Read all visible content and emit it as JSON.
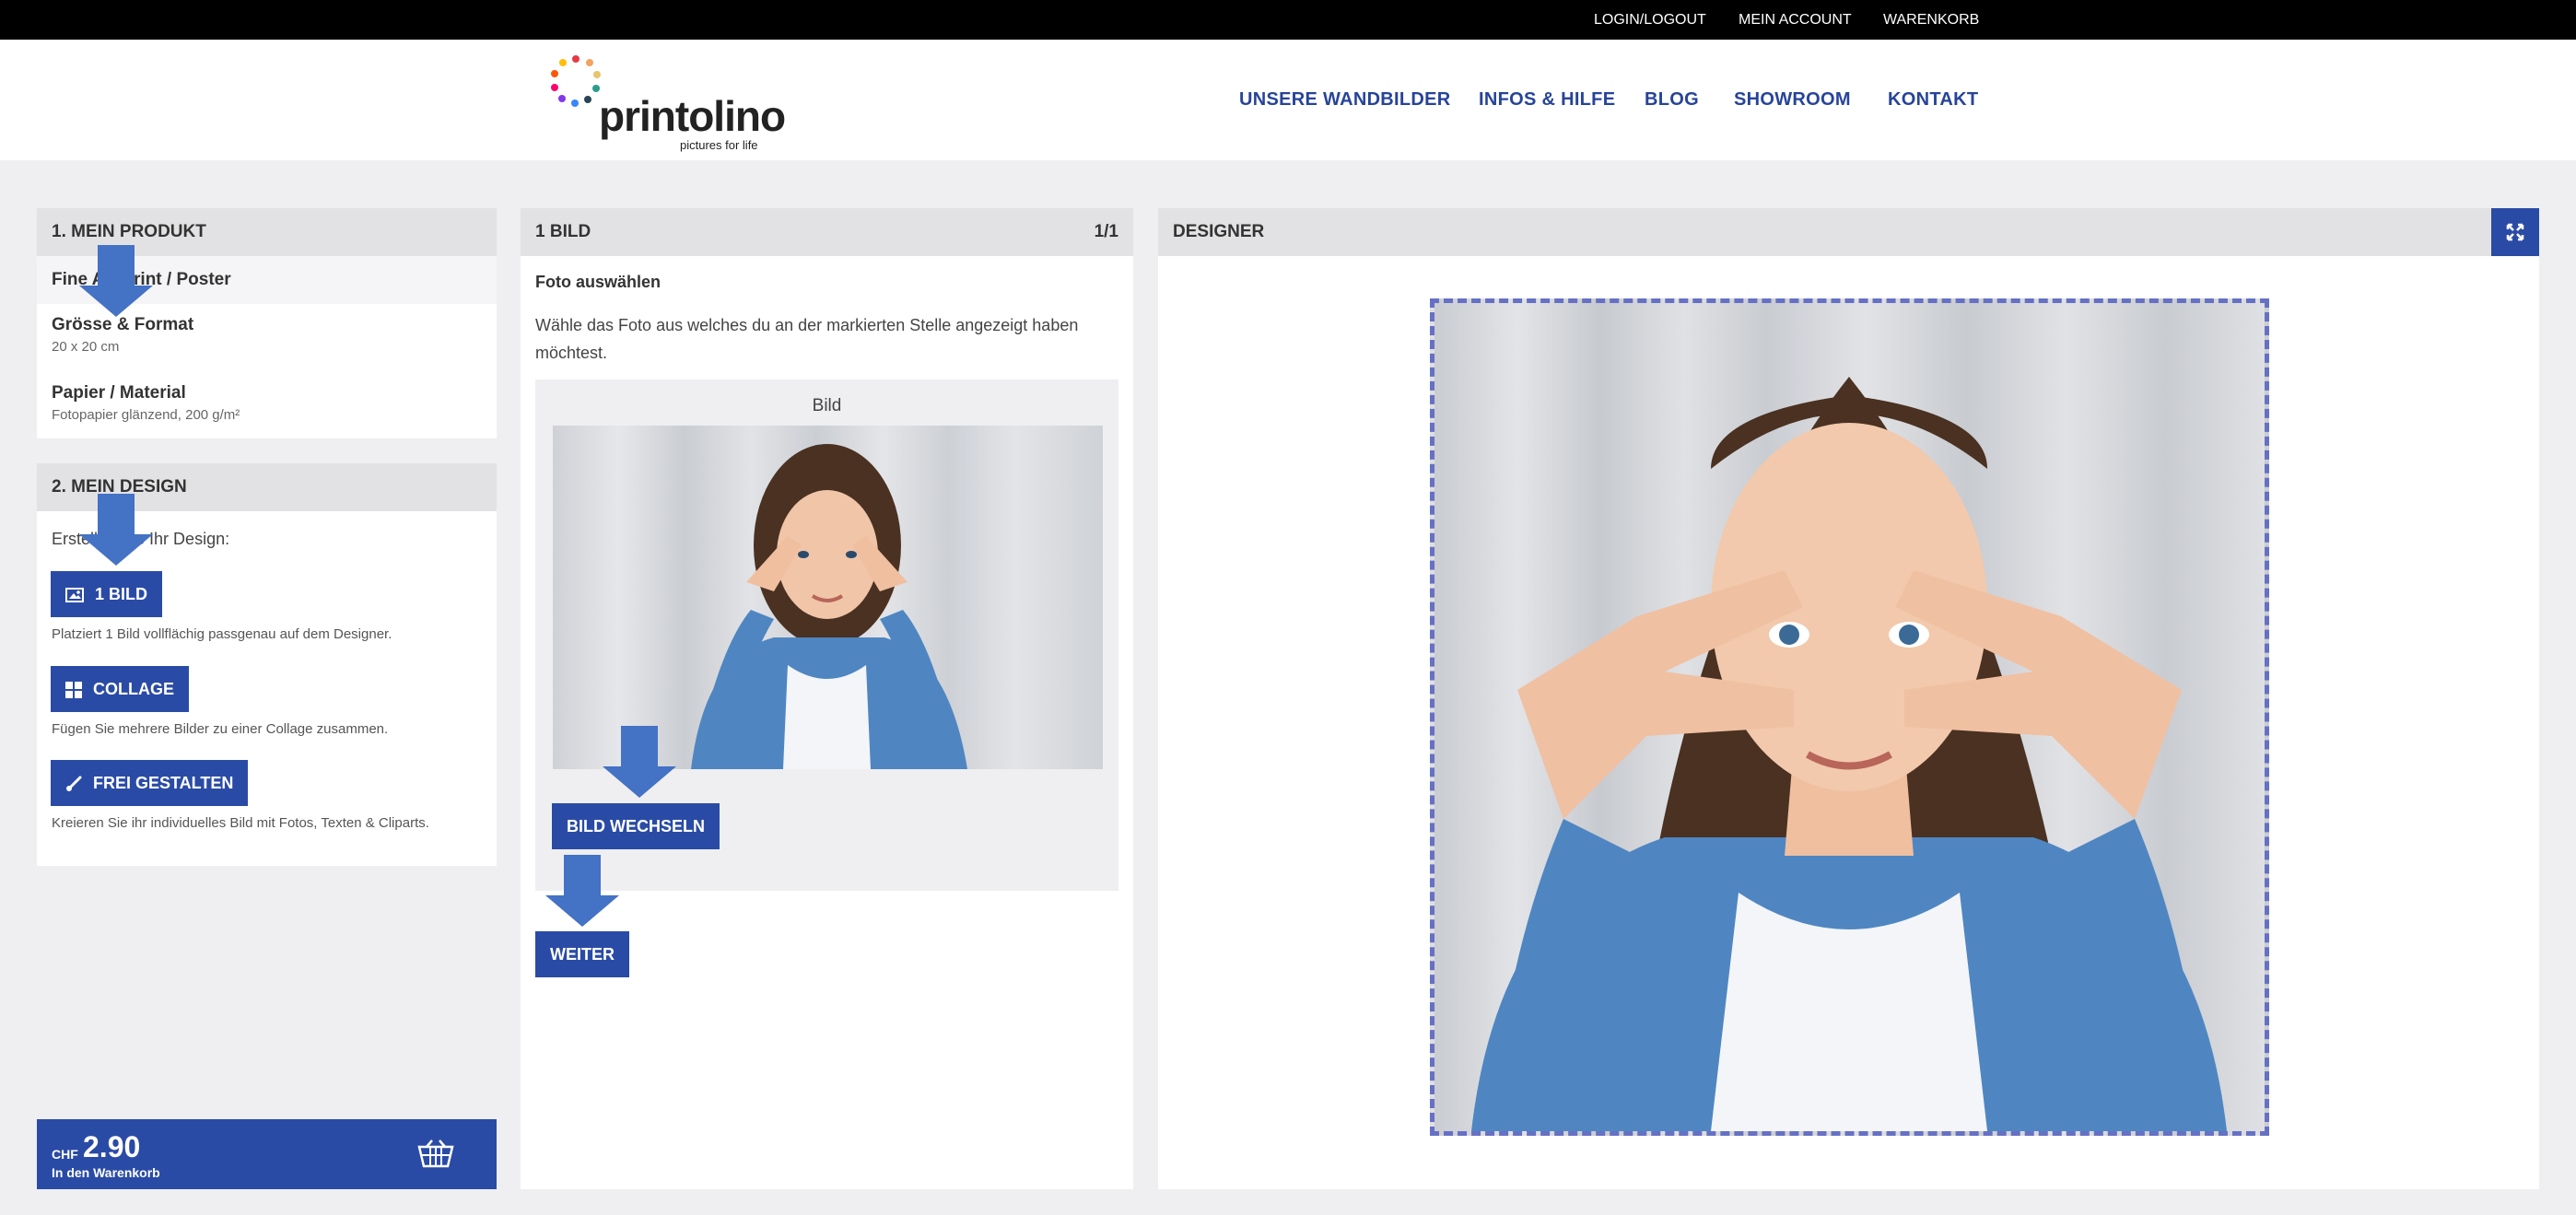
{
  "topbar": {
    "login": "LOGIN/LOGOUT",
    "account": "MEIN ACCOUNT",
    "cart": "WARENKORB"
  },
  "logo": {
    "name": "printolino",
    "tagline": "pictures for life"
  },
  "nav": {
    "items": [
      "UNSERE WANDBILDER",
      "INFOS & HILFE",
      "BLOG",
      "SHOWROOM",
      "KONTAKT"
    ]
  },
  "product": {
    "heading": "1. MEIN PRODUKT",
    "type": "Fine Art Print / Poster",
    "size_label": "Grösse & Format",
    "size_value": "20 x 20 cm",
    "material_label": "Papier / Material",
    "material_value": "Fotopapier glänzend, 200 g/m²"
  },
  "design": {
    "heading": "2. MEIN DESIGN",
    "intro": "Erstellen Sie Ihr Design:",
    "option1_label": "1 BILD",
    "option1_desc": "Platziert 1 Bild vollflächig passgenau auf dem Designer.",
    "option2_label": "COLLAGE",
    "option2_desc": "Fügen Sie mehrere Bilder zu einer Collage zusammen.",
    "option3_label": "FREI GESTALTEN",
    "option3_desc": "Kreieren Sie ihr individuelles Bild mit Fotos, Texten & Cliparts."
  },
  "cartbox": {
    "currency": "CHF",
    "price": "2.90",
    "label": "In den Warenkorb"
  },
  "bild": {
    "heading": "1 BILD",
    "pager": "1/1",
    "title": "Foto auswählen",
    "text": "Wähle das Foto aus welches du an der markierten Stelle angezeigt haben möchtest.",
    "card_title": "Bild",
    "change_button": "BILD WECHSELN",
    "next_button": "WEITER"
  },
  "designer": {
    "heading": "DESIGNER"
  },
  "icons": {
    "expand": "expand-icon",
    "image": "image-icon",
    "grid": "grid-icon",
    "brush": "brush-icon",
    "basket": "basket-icon"
  },
  "colors": {
    "accent": "#2a4ba5",
    "nav": "#27449a",
    "arrow": "#4472c4",
    "frame_border": "#6670c4"
  }
}
